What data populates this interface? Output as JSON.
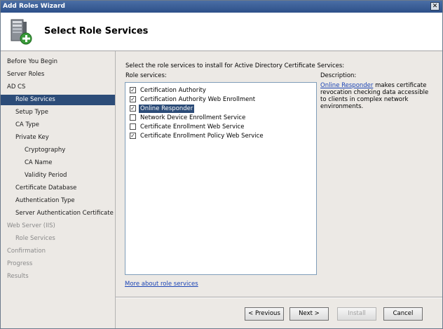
{
  "window": {
    "title": "Add Roles Wizard",
    "close_glyph": "✕"
  },
  "header": {
    "title": "Select Role Services",
    "icon": "server-add-icon"
  },
  "sidebar": {
    "items": [
      {
        "label": "Before You Begin",
        "state": "normal"
      },
      {
        "label": "Server Roles",
        "state": "normal"
      },
      {
        "label": "AD CS",
        "state": "normal"
      },
      {
        "label": "Role Services",
        "state": "selected"
      },
      {
        "label": "Setup Type",
        "state": "normal"
      },
      {
        "label": "CA Type",
        "state": "normal"
      },
      {
        "label": "Private Key",
        "state": "normal"
      },
      {
        "label": "Cryptography",
        "state": "normal"
      },
      {
        "label": "CA Name",
        "state": "normal"
      },
      {
        "label": "Validity Period",
        "state": "normal"
      },
      {
        "label": "Certificate Database",
        "state": "normal"
      },
      {
        "label": "Authentication Type",
        "state": "normal"
      },
      {
        "label": "Server Authentication Certificate",
        "state": "normal"
      },
      {
        "label": "Web Server (IIS)",
        "state": "disabled"
      },
      {
        "label": "Role Services",
        "state": "disabled"
      },
      {
        "label": "Confirmation",
        "state": "disabled"
      },
      {
        "label": "Progress",
        "state": "disabled"
      },
      {
        "label": "Results",
        "state": "disabled"
      }
    ]
  },
  "main": {
    "instruction": "Select the role services to install for Active Directory Certificate Services:",
    "role_services_label": "Role services:",
    "description_label": "Description:",
    "role_services": [
      {
        "label": "Certification Authority",
        "checked": true
      },
      {
        "label": "Certification Authority Web Enrollment",
        "checked": true
      },
      {
        "label": "Online Responder",
        "checked": true,
        "selected": true
      },
      {
        "label": "Network Device Enrollment Service",
        "checked": false
      },
      {
        "label": "Certificate Enrollment Web Service",
        "checked": false
      },
      {
        "label": "Certificate Enrollment Policy Web Service",
        "checked": true
      }
    ],
    "description": {
      "link": "Online Responder",
      "text": " makes certificate revocation checking data accessible to clients in complex network environments."
    },
    "more_link": "More about role services"
  },
  "buttons": {
    "previous": "< Previous",
    "next": "Next >",
    "install": "Install",
    "cancel": "Cancel"
  },
  "colors": {
    "titlebar": "#2d5089",
    "selection": "#2c4c78",
    "link": "#1b44b5",
    "panel": "#ece9e5"
  }
}
